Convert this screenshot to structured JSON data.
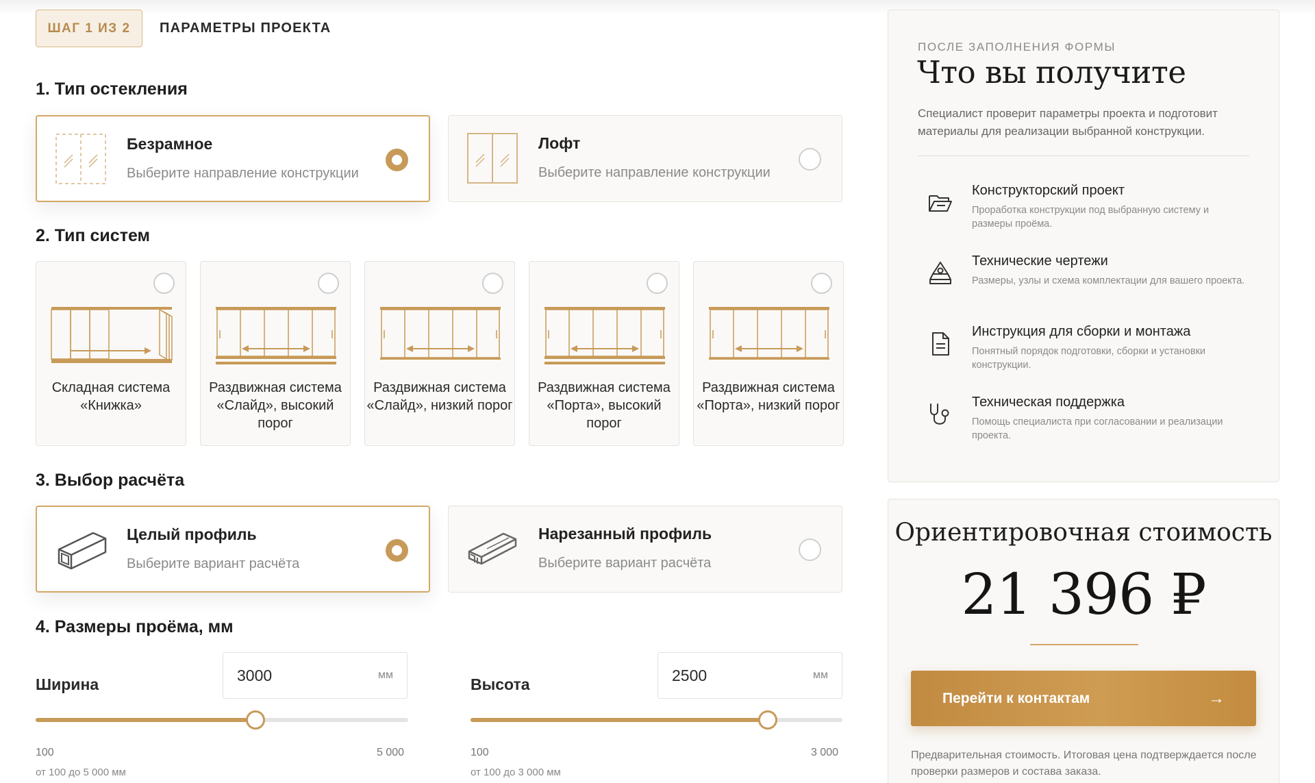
{
  "step": {
    "badge": "ШАГ 1 ИЗ 2",
    "title": "ПАРАМЕТРЫ ПРОЕКТА"
  },
  "glazing": {
    "title": "1. Тип остекления",
    "options": [
      {
        "name": "Безрамное",
        "sub": "Выберите направление конструкции",
        "selected": true,
        "icon": "frameless-glass-icon"
      },
      {
        "name": "Лофт",
        "sub": "Выберите направление конструкции",
        "selected": false,
        "icon": "loft-glass-icon"
      }
    ]
  },
  "systems": {
    "title": "2. Тип систем",
    "items": [
      {
        "label": "Складная система «Книжка»",
        "selected": false,
        "icon": "folding-system-icon"
      },
      {
        "label": "Раздвижная система «Слайд», высокий порог",
        "selected": false,
        "icon": "sliding-high-icon"
      },
      {
        "label": "Раздвижная система «Слайд», низкий порог",
        "selected": false,
        "icon": "sliding-low-icon"
      },
      {
        "label": "Раздвижная система «Порта», высокий порог",
        "selected": false,
        "icon": "porta-high-icon"
      },
      {
        "label": "Раздвижная система «Порта», низкий порог",
        "selected": false,
        "icon": "porta-low-icon"
      }
    ]
  },
  "calc": {
    "title": "3. Выбор расчёта",
    "options": [
      {
        "name": "Целый профиль",
        "sub": "Выберите вариант расчёта",
        "selected": true,
        "icon": "solid-profile-icon"
      },
      {
        "name": "Нарезанный профиль",
        "sub": "Выберите вариант расчёта",
        "selected": false,
        "icon": "cut-profile-icon"
      }
    ]
  },
  "dims": {
    "title": "4. Размеры проёма, мм",
    "width": {
      "label": "Ширина",
      "value": "3000",
      "unit": "мм",
      "min": "100",
      "max": "5 000",
      "note": "от 100 до 5 000 мм",
      "fraction": 0.59
    },
    "height": {
      "label": "Высота",
      "value": "2500",
      "unit": "мм",
      "min": "100",
      "max": "3 000",
      "note": "от 100 до 3 000 мм",
      "fraction": 0.8
    }
  },
  "info": {
    "kicker": "ПОСЛЕ ЗАПОЛНЕНИЯ ФОРМЫ",
    "title": "Что вы получите",
    "desc": "Специалист проверит параметры проекта и подготовит материалы для реализации выбранной конструкции.",
    "features": [
      {
        "title": "Конструкторский проект",
        "desc": "Проработка конструкции под выбранную систему и размеры проёма.",
        "icon": "folder-icon"
      },
      {
        "title": "Технические чертежи",
        "desc": "Размеры, узлы и схема комплектации для вашего проекта.",
        "icon": "drafting-icon"
      },
      {
        "title": "Инструкция для сборки и монтажа",
        "desc": "Понятный порядок подготовки, сборки и установки конструкции.",
        "icon": "document-icon"
      },
      {
        "title": "Техническая поддержка",
        "desc": "Помощь специалиста при согласовании и реализации проекта.",
        "icon": "stethoscope-icon"
      }
    ]
  },
  "price": {
    "title": "Ориентировочная стоимость",
    "value": "21 396 ₽",
    "cta": "Перейти к контактам",
    "cta_arrow": "→",
    "note": "Предварительная стоимость. Итоговая цена подтверждается после проверки размеров и состава заказа."
  },
  "colors": {
    "accent": "#c79a59",
    "border": "#e6e3de",
    "panel": "#f9f8f6"
  }
}
